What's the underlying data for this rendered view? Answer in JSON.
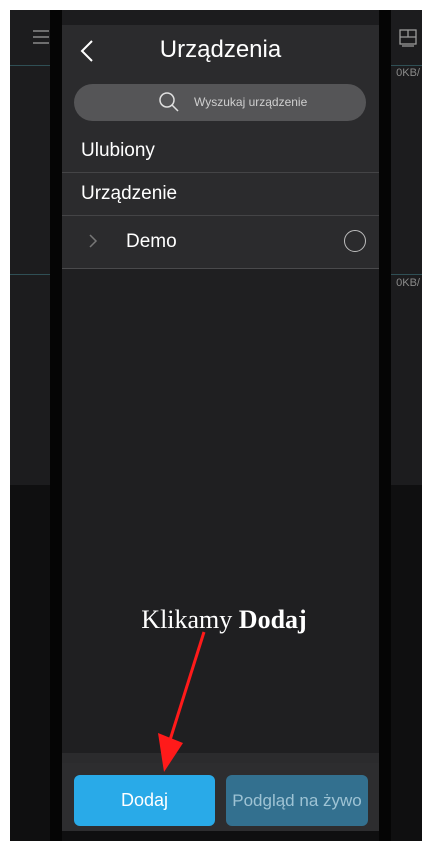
{
  "background": {
    "speed_top": "0KB/",
    "speed_mid": "0KB/"
  },
  "header": {
    "title": "Urządzenia"
  },
  "search": {
    "placeholder": "Wyszukaj urządzenie"
  },
  "list": {
    "favorites_label": "Ulubiony",
    "devices_label": "Urządzenie",
    "device_name": "Demo"
  },
  "annotation": {
    "prefix": "Klikamy ",
    "bold": "Dodaj"
  },
  "buttons": {
    "add_label": "Dodaj",
    "live_label": "Podgląd na żywo"
  },
  "colors": {
    "accent": "#29aae8",
    "arrow": "#ff1a1a"
  }
}
